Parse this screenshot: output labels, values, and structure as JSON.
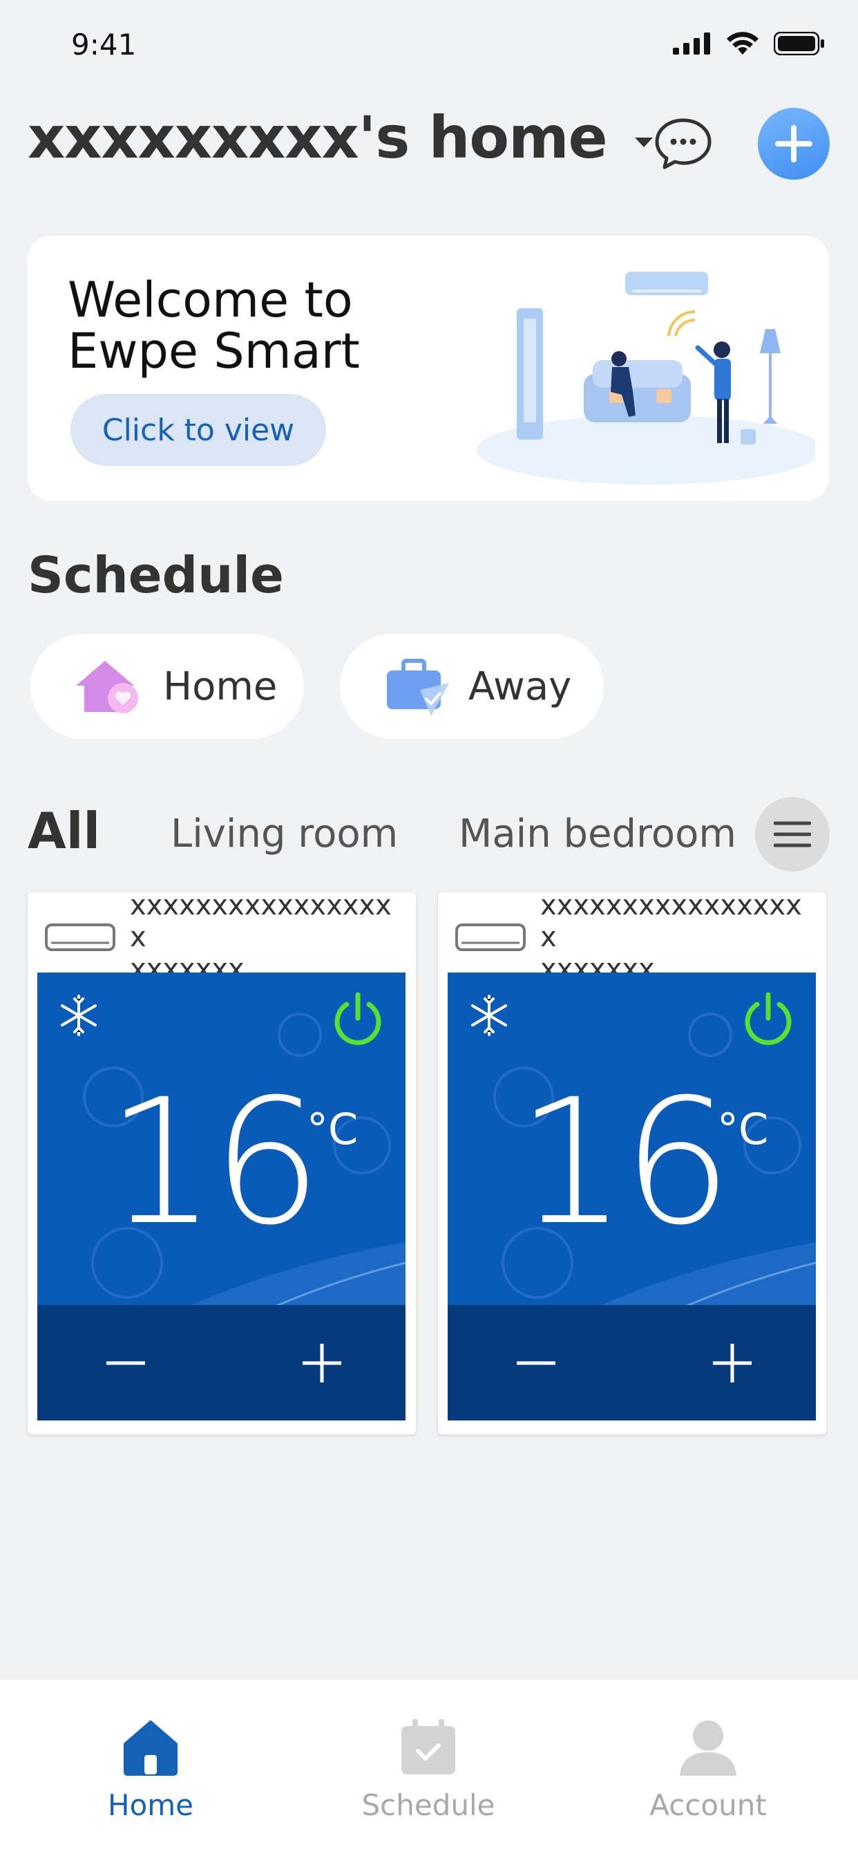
{
  "status_bar": {
    "time": "9:41"
  },
  "header": {
    "home_title": "xxxxxxxxx's home"
  },
  "welcome": {
    "title_line1": "Welcome to",
    "title_line2": "Ewpe Smart",
    "button_label": "Click to view"
  },
  "schedule": {
    "title": "Schedule",
    "modes": [
      {
        "label": "Home",
        "icon": "home-heart-icon"
      },
      {
        "label": "Away",
        "icon": "suitcase-icon"
      }
    ]
  },
  "rooms": {
    "tabs": [
      "All",
      "Living room",
      "Main bedroom"
    ],
    "active": "All"
  },
  "devices": [
    {
      "name": "xxxxxxxxxxxxxxxxx\nxxxxxxx",
      "temperature": "16",
      "unit": "°C",
      "mode": "snowflake-icon",
      "power": "on"
    },
    {
      "name": "xxxxxxxxxxxxxxxxx\nxxxxxxx",
      "temperature": "16",
      "unit": "°C",
      "mode": "snowflake-icon",
      "power": "on"
    }
  ],
  "bottom_nav": {
    "items": [
      {
        "label": "Home",
        "icon": "home-icon",
        "active": true
      },
      {
        "label": "Schedule",
        "icon": "calendar-check-icon",
        "active": false
      },
      {
        "label": "Account",
        "icon": "person-icon",
        "active": false
      }
    ]
  },
  "colors": {
    "accent": "#1561b7",
    "panel": "#0a5bb8",
    "panel_dark": "#063a7e",
    "power_on": "#57e231",
    "background": "#f1f2f4"
  }
}
